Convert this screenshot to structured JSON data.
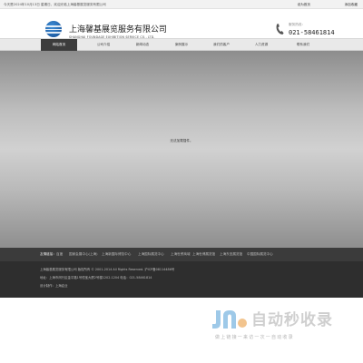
{
  "topbar": {
    "greeting": "今天是2024年10月13日 星期日，欢迎光临上海馨基展览服务有限公司",
    "home_link": "设为首页",
    "fav_link": "添加收藏"
  },
  "header": {
    "logo_sub": "FOUNDAGE",
    "company_cn": "上海馨基展览服务有限公司",
    "company_en": "SHANGHAI FOUNDAGE EXHIBITION SERVICE CO., LTD.",
    "hotline_label": "服务热线：",
    "hotline_number": "021-58461814"
  },
  "nav": {
    "items": [
      {
        "label": "网站首页"
      },
      {
        "label": "公司介绍"
      },
      {
        "label": "新闻动态"
      },
      {
        "label": "案例展示"
      },
      {
        "label": "我们的客户"
      },
      {
        "label": "人力资源"
      },
      {
        "label": "联系我们"
      }
    ]
  },
  "banner": {
    "message": "无法加载插件。"
  },
  "footer": {
    "links_label": "友情链接：",
    "links": [
      {
        "label": "百度"
      },
      {
        "label": "国家会展中心(上海)"
      },
      {
        "label": "上海新国际博览中心"
      },
      {
        "label": "上海国际展览中心"
      },
      {
        "label": "上海世贸商城"
      },
      {
        "label": "上海世博展览馆"
      },
      {
        "label": "上海东亚展览馆"
      },
      {
        "label": "中国国际展览中心"
      }
    ],
    "copyright": "上海馨基展览服务有限公司 版权所有 © 2001-2014 All Rights Reserved. 沪ICP备08114486号",
    "address": "地址：上海市闵行区金平路1号恒宝大厦2号楼1202-1204   电话：021-58461814",
    "designer": "设计制作：上海启业"
  },
  "watermark": {
    "title": "自动秒收录",
    "slogan": "做上链接一来访一次一自动收录"
  },
  "colors": {
    "nav_active": "#3c3c3c",
    "footer_dark": "#2e2e2e",
    "logo_blue": "#1b5fae",
    "logo_orange": "#d9872b"
  }
}
